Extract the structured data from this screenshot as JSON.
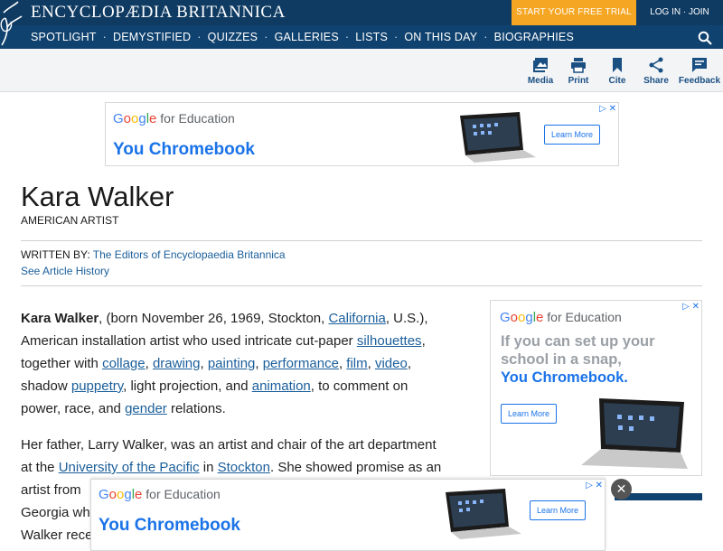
{
  "header": {
    "brand": "ENCYCLOPÆDIA BRITANNICA",
    "trial": "START YOUR FREE TRIAL",
    "login": "LOG IN · JOIN",
    "nav": [
      "SPOTLIGHT",
      "DEMYSTIFIED",
      "QUIZZES",
      "GALLERIES",
      "LISTS",
      "ON THIS DAY",
      "BIOGRAPHIES"
    ]
  },
  "toolbar": {
    "media": "Media",
    "print": "Print",
    "cite": "Cite",
    "share": "Share",
    "feedback": "Feedback"
  },
  "ads": {
    "gfe_brand": "Google",
    "gfe_rest": "for Education",
    "top_headline": "You Chromebook",
    "side_line1": "If you can set up your",
    "side_line2": "school in a snap,",
    "side_line3": "You Chromebook.",
    "bottom_headline": "You Chromebook",
    "learn": "Learn More",
    "adchoices": "▷ ✕"
  },
  "article": {
    "title": "Kara Walker",
    "subtitle": "AMERICAN ARTIST",
    "written_by": "WRITTEN BY:",
    "author": "The Editors of Encyclopaedia Britannica",
    "history": "See Article History",
    "p1_name": "Kara Walker",
    "p1_a": ", (born November 26, 1969, Stockton, ",
    "california": "California",
    "p1_b": ", U.S.),",
    "p1_c": "American installation artist who used intricate cut-paper ",
    "silhouettes": "silhouettes",
    "p1_d": ",",
    "p1_e": "together with ",
    "collage": "collage",
    "drawing": "drawing",
    "painting": "painting",
    "performance": "performance",
    "film": "film",
    "video": "video",
    "p1_f": "shadow ",
    "puppetry": "puppetry",
    "p1_g": ", light projection, and ",
    "animation": "animation",
    "p1_h": ", to comment on",
    "p1_i": "power, race, and ",
    "gender": "gender",
    "p1_j": " relations.",
    "p2_a": "Her father, Larry Walker, was an artist and chair of the art department",
    "p2_b": "at the ",
    "uop": "University of the Pacific",
    "p2_c": " in ",
    "stockton": "Stockton",
    "p2_d": ". She showed promise as an",
    "p2_e": "artist from",
    "p2_f": "Georgia wh",
    "p2_g": "Walker rece",
    "close": "✕"
  }
}
